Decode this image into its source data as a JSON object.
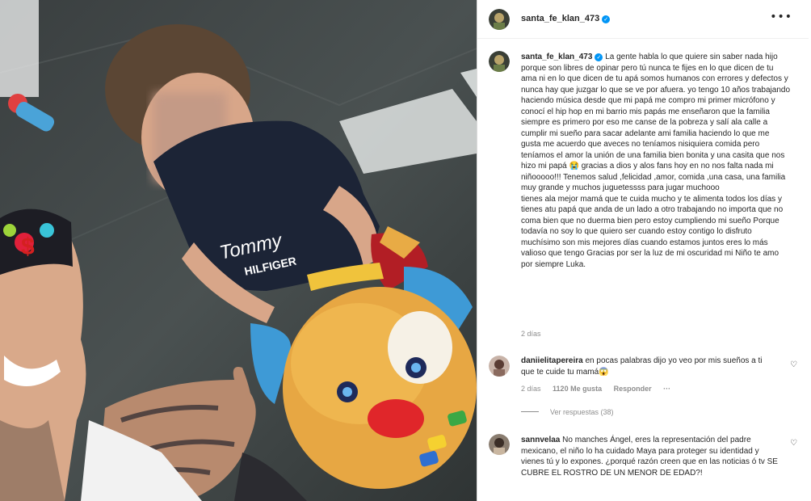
{
  "post": {
    "username": "santa_fe_klan_473",
    "more_icon": "more-horizontal-icon",
    "verified_icon": "verified-badge-icon"
  },
  "caption": {
    "username": "santa_fe_klan_473",
    "text": "La gente habla lo que quiere sin saber nada hijo porque son libres de opinar pero tú nunca te fijes en lo que dicen de tu ama ni en lo que dicen de tu apá somos humanos con errores y defectos y nunca hay que juzgar lo que se ve por afuera. yo tengo 10 años trabajando haciendo música desde que mi papá me compro mi primer micrófono y conocí el hip hop en mi barrio mis papás me enseñaron que la familia siempre es primero por eso me canse de la pobreza y salí ala calle a cumplir mi sueño para sacar adelante ami familia haciendo lo que me gusta me acuerdo que aveces no teníamos nisiquiera comida pero teníamos el amor la unión de una familia bien bonita y una casita que nos hizo mi papá 😭 gracias a dios y alos fans hoy en no nos falta nada mi niñooooo!!! Tenemos salud ,felicidad ,amor, comida ,una casa, una familia muy grande y muchos juguetessss para jugar muchooo\ntienes ala mejor mamá que te cuida mucho y te alimenta todos los días y tienes atu papá que anda de un lado a otro trabajando no importa que no coma bien que no duerma bien pero estoy cumpliendo mi sueño Porque todavía no soy lo que quiero ser cuando estoy contigo lo disfruto muchísimo son mis mejores días cuando estamos juntos eres lo más valioso que tengo Gracias por ser la luz de mi oscuridad mi Niño te amo por siempre Luka.",
    "time": "2 días"
  },
  "comments": [
    {
      "username": "daniielitapereira",
      "text": "en pocas palabras dijo yo veo por mis sueños a ti que te cuide tu mamá😱",
      "time": "2 días",
      "likes": "1120 Me gusta",
      "reply_label": "Responder",
      "more": "···",
      "view_replies": "Ver respuestas (38)",
      "heart_icon": "heart-outline-icon"
    },
    {
      "username": "sannvelaa",
      "text": "No manches Ángel, eres la representación del padre mexicano, el niño lo ha cuidado Maya para proteger su identidad y vienes tú y lo expones. ¿porqué razón creen que en las noticias ó tv SE CUBRE EL ROSTRO DE UN MENOR DE EDAD?!",
      "heart_icon": "heart-outline-icon"
    }
  ],
  "photo": {
    "shirt_text_line1": "Tommy",
    "shirt_text_line2": "HILFIGER",
    "cap_text": "$"
  }
}
